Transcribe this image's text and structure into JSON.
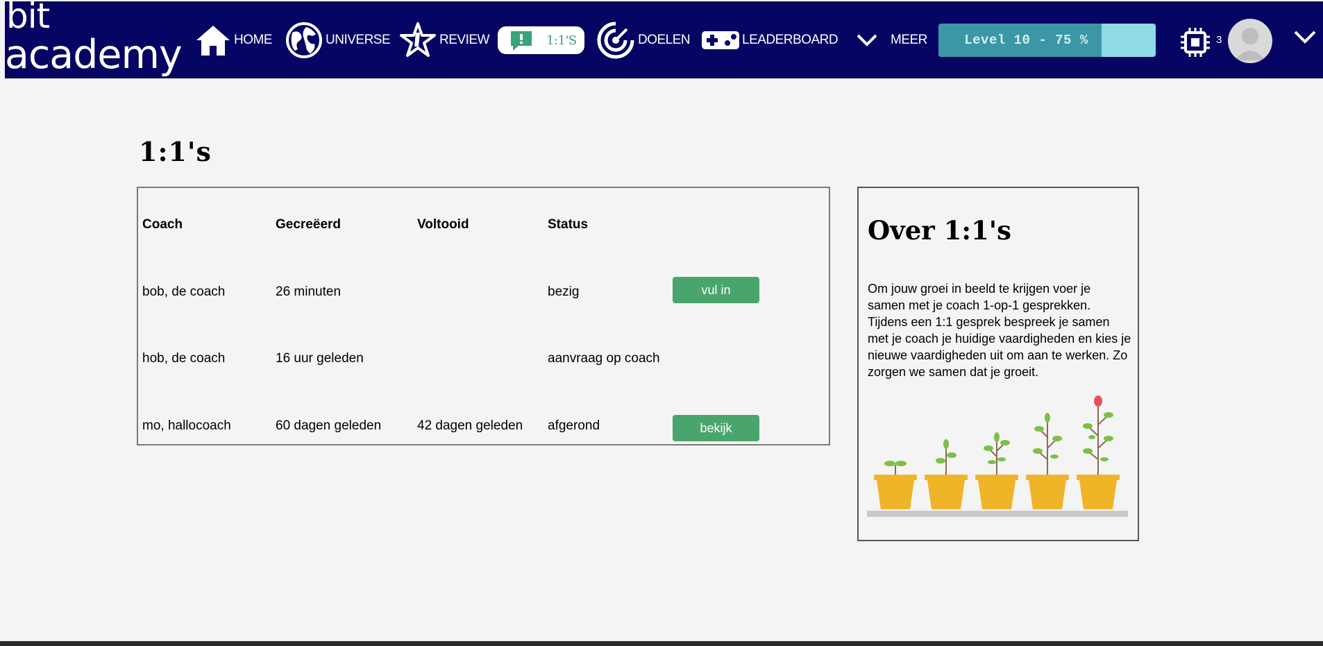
{
  "brand": {
    "line1": "bit",
    "line2": "academy"
  },
  "nav": {
    "home": "HOME",
    "universe": "UNIVERSE",
    "review": "REVIEW",
    "one_on_one": "1:1'S",
    "doelen": "DOELEN",
    "leaderboard": "LEADERBOARD",
    "meer": "MEER"
  },
  "level": {
    "label": "Level 10 - 75 %",
    "progress": 0.75
  },
  "chip_count": "3",
  "page": {
    "title": "1:1's"
  },
  "table": {
    "headers": {
      "coach": "Coach",
      "created": "Gecreëerd",
      "completed": "Voltooid",
      "status": "Status"
    },
    "rows": [
      {
        "coach": "bob, de coach",
        "created": "26 minuten",
        "completed": "",
        "status": "bezig",
        "action": "vul in"
      },
      {
        "coach": "hob, de coach",
        "created": "16 uur geleden",
        "completed": "",
        "status": "aanvraag op coach",
        "action": ""
      },
      {
        "coach": "mo, hallocoach",
        "created": "60 dagen geleden",
        "completed": "42 dagen geleden",
        "status": "afgerond",
        "action": "bekijk"
      }
    ]
  },
  "about": {
    "title": "Over 1:1's",
    "text": "Om jouw groei in beeld te krijgen voer je samen met je coach 1-op-1 gesprekken. Tijdens een 1:1 gesprek bespreek je samen met je coach je huidige vaardigheden en kies je nieuwe vaardigheden uit om aan te werken. Zo zorgen we samen dat je groeit."
  },
  "colors": {
    "nav_bg": "#060563",
    "accent_green": "#4aa56c",
    "level_fill": "#3b97a6",
    "level_bg": "#8fdbe6",
    "pot": "#f0b429"
  }
}
